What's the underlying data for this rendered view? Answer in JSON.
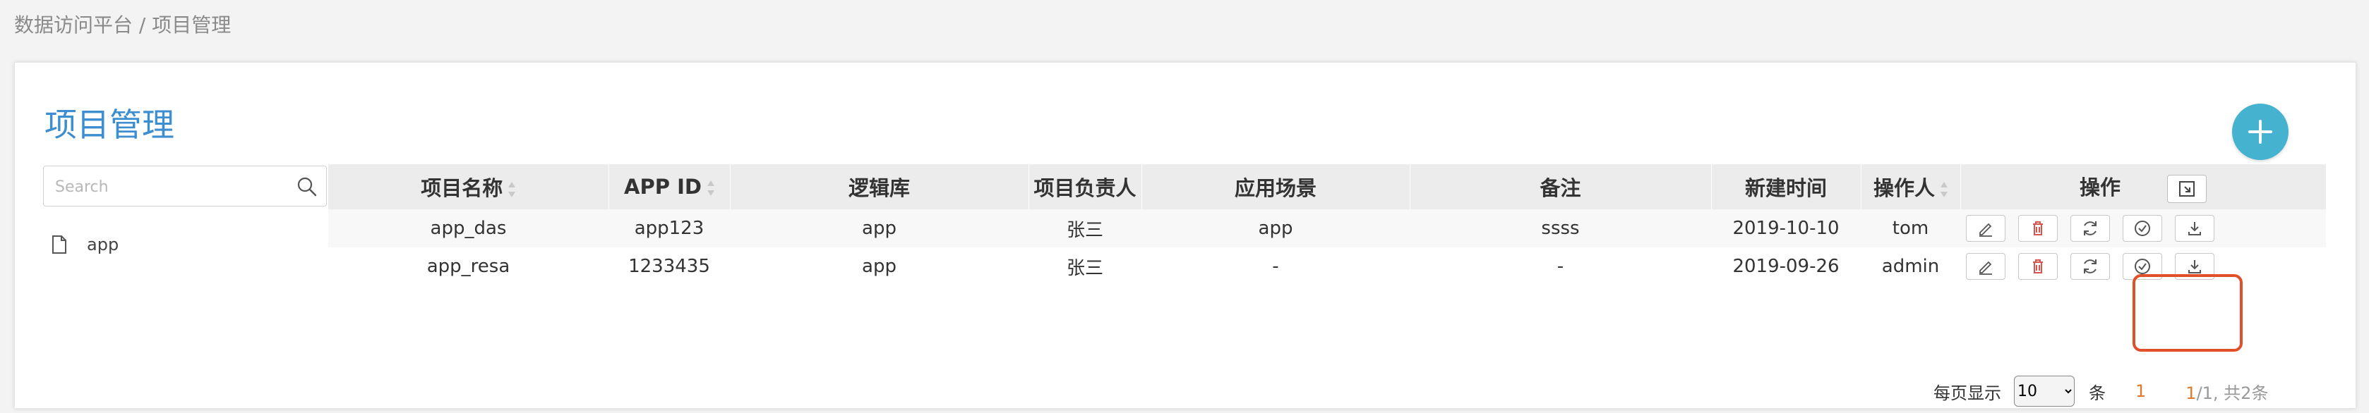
{
  "breadcrumb": "数据访问平台 / 项目管理",
  "page_title": "项目管理",
  "add_button_symbol": "+",
  "search": {
    "placeholder": "Search",
    "value": ""
  },
  "tree": [
    {
      "label": "app",
      "icon": "file-icon"
    }
  ],
  "table": {
    "columns": [
      {
        "label": "项目名称",
        "sortable": true
      },
      {
        "label": "APP ID",
        "sortable": true
      },
      {
        "label": "逻辑库",
        "sortable": false
      },
      {
        "label": "项目负责人",
        "sortable": false
      },
      {
        "label": "应用场景",
        "sortable": false
      },
      {
        "label": "备注",
        "sortable": false
      },
      {
        "label": "新建时间",
        "sortable": false
      },
      {
        "label": "操作人",
        "sortable": true
      },
      {
        "label": "操作",
        "sortable": false
      }
    ],
    "rows": [
      {
        "name": "app_das",
        "app_id": "app123",
        "logic_db": "app",
        "owner": "张三",
        "scenario": "app",
        "remark": "ssss",
        "created": "2019-10-10",
        "operator": "tom"
      },
      {
        "name": "app_resa",
        "app_id": "1233435",
        "logic_db": "app",
        "owner": "张三",
        "scenario": "-",
        "remark": "-",
        "created": "2019-09-26",
        "operator": "admin"
      }
    ],
    "row_actions": [
      "edit-icon",
      "delete-icon",
      "sync-icon",
      "check-circle-icon",
      "download-icon"
    ]
  },
  "pager": {
    "per_page_label": "每页显示",
    "per_page_value": "10",
    "per_page_unit": "条",
    "current_page": "1",
    "page_info_current": "1",
    "page_info_rest": "/1, 共2条"
  },
  "colors": {
    "title": "#3d8ed0",
    "add_button": "#45b2cf",
    "delete": "#d9534f",
    "highlight": "#e0502a",
    "page_accent": "#e07a2a"
  }
}
